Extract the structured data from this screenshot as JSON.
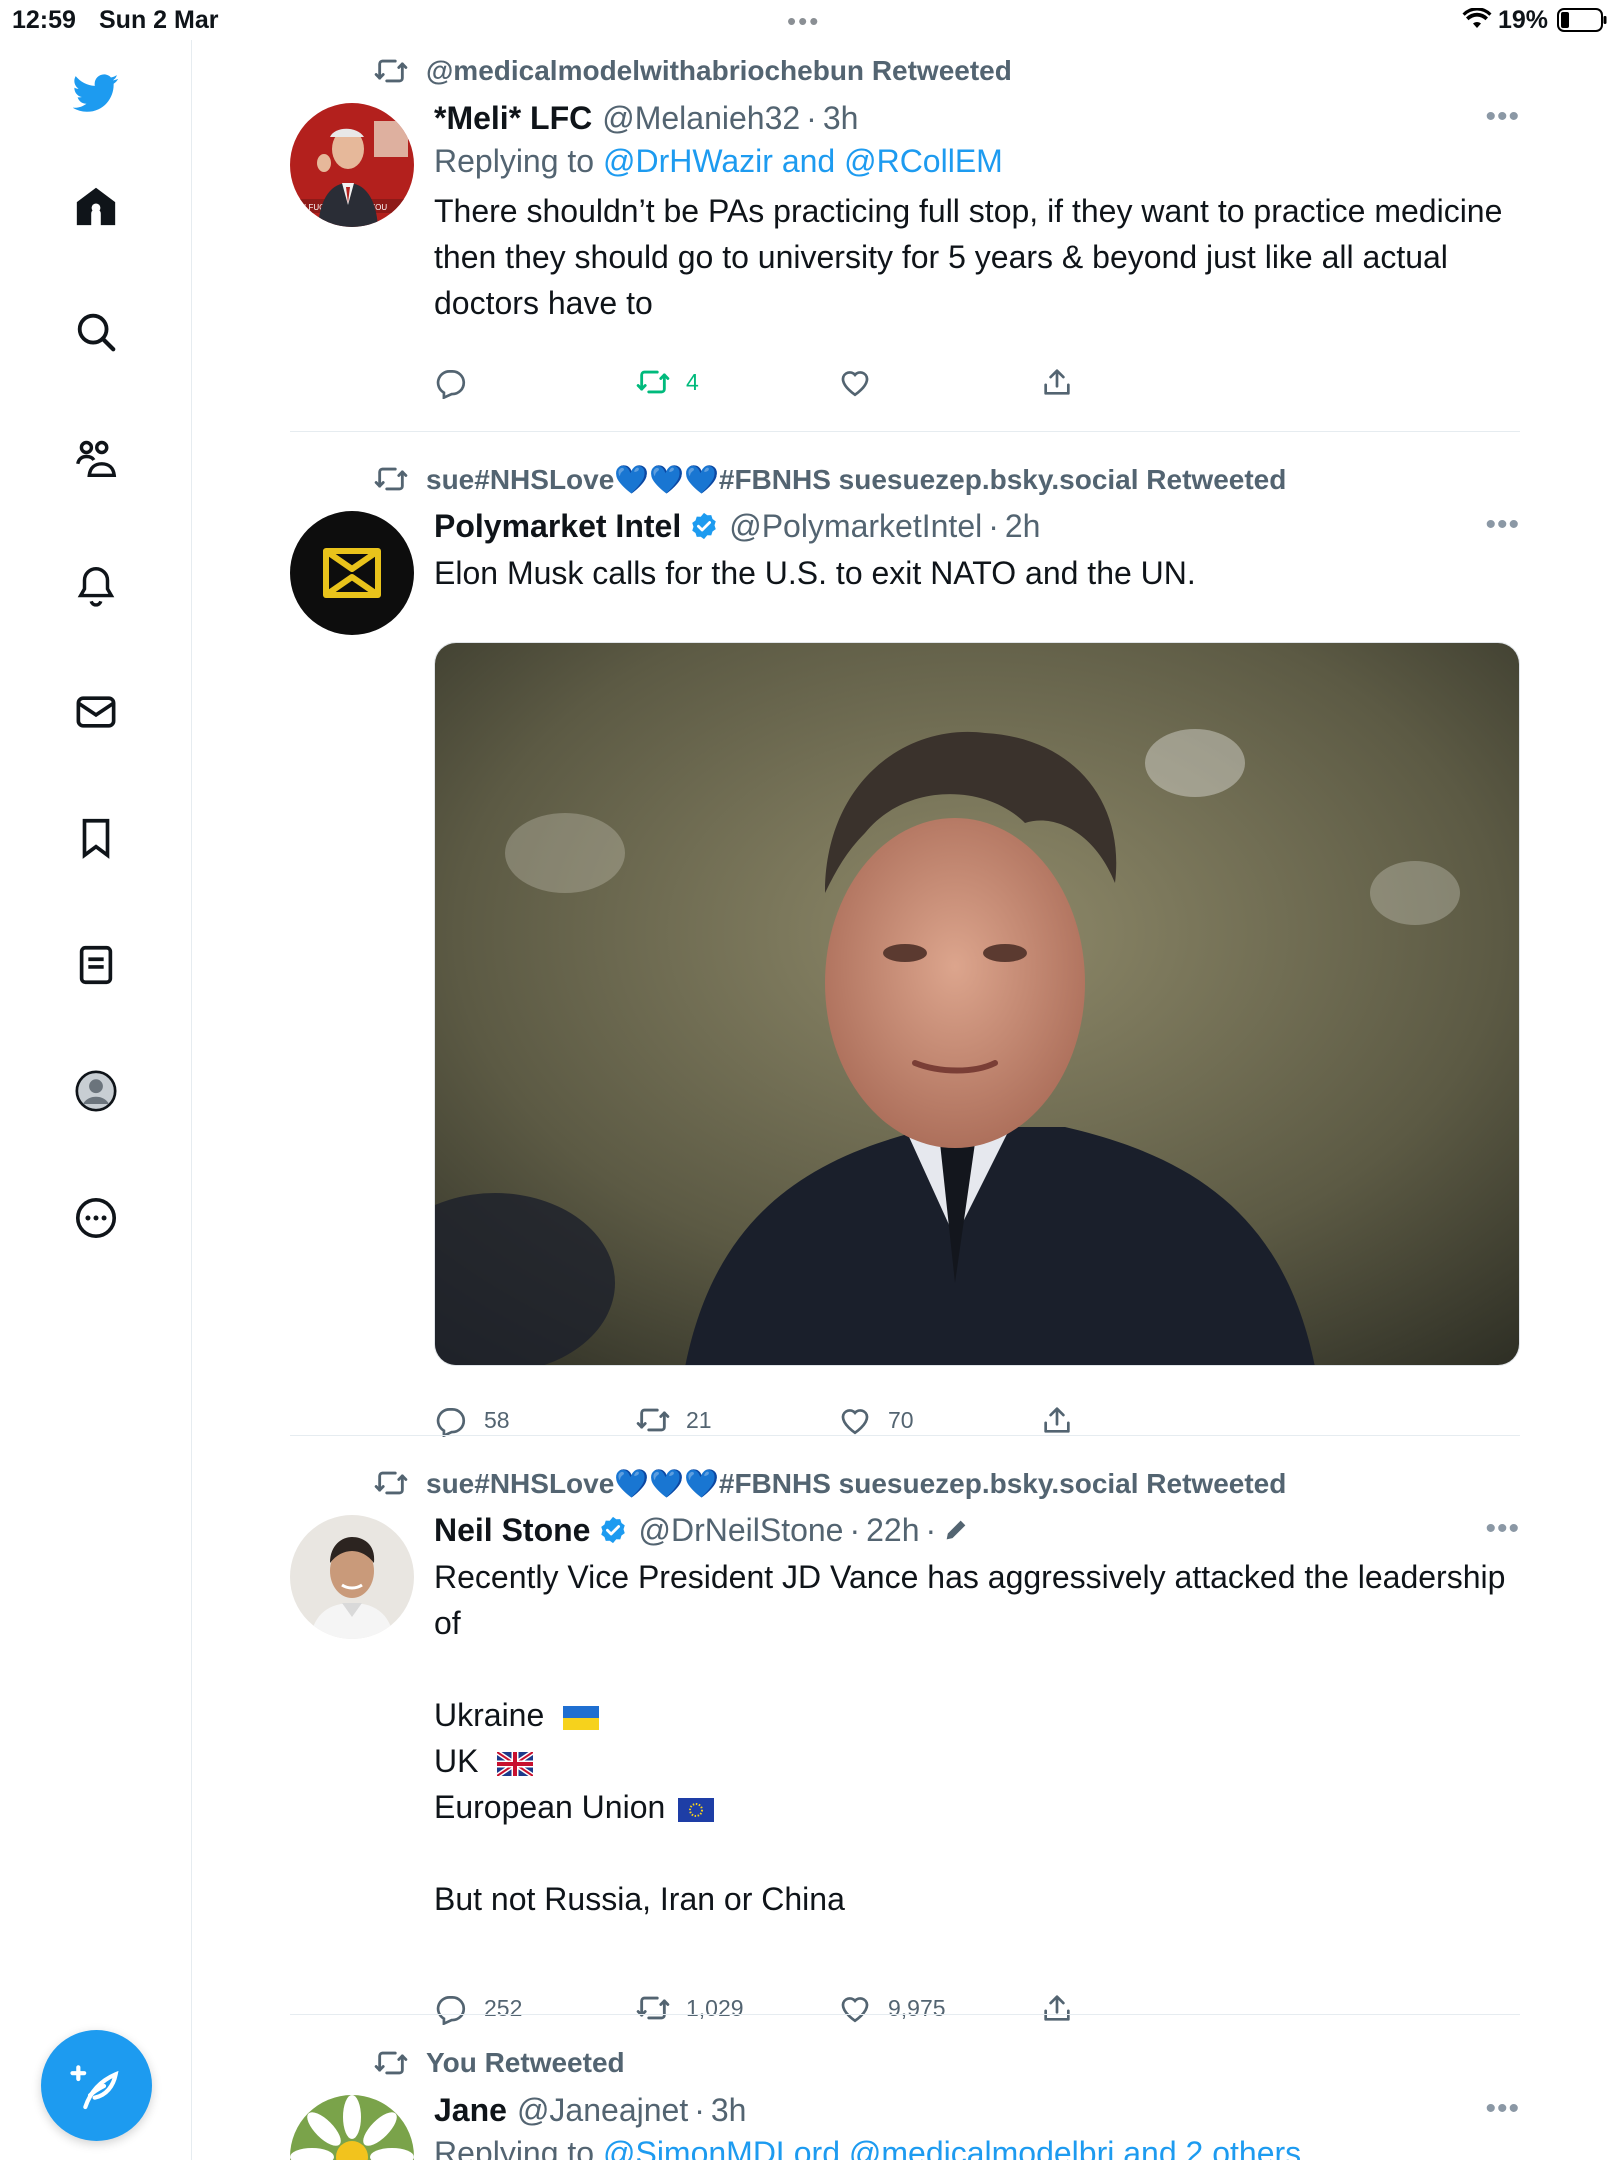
{
  "status_bar": {
    "time": "12:59",
    "date": "Sun 2 Mar",
    "battery": "19%"
  },
  "colors": {
    "brand": "#1d9bf0",
    "retweet_active": "#00ba7c",
    "secondary_text": "#536471"
  },
  "sidebar": {
    "items": [
      {
        "name": "twitter-logo-icon"
      },
      {
        "name": "home-icon"
      },
      {
        "name": "search-icon"
      },
      {
        "name": "communities-icon"
      },
      {
        "name": "notifications-icon"
      },
      {
        "name": "messages-icon"
      },
      {
        "name": "bookmarks-icon"
      },
      {
        "name": "lists-icon"
      },
      {
        "name": "profile-icon"
      },
      {
        "name": "more-icon"
      }
    ],
    "compose": "compose-icon"
  },
  "feed": {
    "tweets": [
      {
        "retweeted_by": "@medicalmodelwithabriochebun Retweeted",
        "name": "*Meli* LFC",
        "handle": "@Melanieh32",
        "time": "3h",
        "replying_prefix": "Replying to",
        "replying_to": "@DrHWazir and @RCollEM",
        "text": [
          "There shouldn’t be PAs practicing full stop, if they want to practice medicine then they should go to university for 5 years & beyond just like all actual doctors have to"
        ],
        "replies": "",
        "retweets": "4",
        "likes": "",
        "avatar_text": "I FUCKING TOLD YOU"
      },
      {
        "retweeted_by": "sue#NHSLove💙💙💙#FBNHS suesuezep.bsky.social Retweeted",
        "name": "Polymarket Intel",
        "handle": "@PolymarketIntel",
        "time": "2h",
        "text": [
          "Elon Musk calls for the U.S. to exit NATO and the UN."
        ],
        "replies": "58",
        "retweets": "21",
        "likes": "70"
      },
      {
        "retweeted_by": "sue#NHSLove💙💙💙#FBNHS suesuezep.bsky.social Retweeted",
        "name": "Neil Stone",
        "handle": "@DrNeilStone",
        "time": "22h",
        "text": [
          "Recently Vice President JD Vance has aggressively attacked the leadership of",
          "",
          "Ukraine",
          "UK",
          "European Union",
          "",
          "But not Russia, Iran or China"
        ],
        "replies": "252",
        "retweets": "1,029",
        "likes": "9,975"
      },
      {
        "retweeted_by": "You Retweeted",
        "name": "Jane",
        "handle": "@Janeajnet",
        "time": "3h",
        "replying_prefix": "Replying to",
        "replying_to": "@SimonMDLord @medicalmodelbri and 2 others"
      }
    ]
  }
}
